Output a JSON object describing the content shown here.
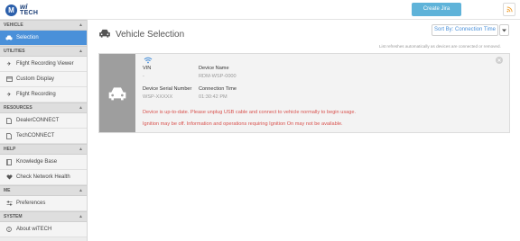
{
  "header": {
    "logo_badge": "M",
    "logo_wi": "wi",
    "logo_tech": "TECH",
    "create_jira": "Create Jira"
  },
  "sidebar": {
    "sections": [
      {
        "title": "VEHICLE",
        "items": [
          {
            "label": "Selection",
            "icon": "car-icon",
            "active": true
          }
        ]
      },
      {
        "title": "UTILITIES",
        "items": [
          {
            "label": "Flight Recording Viewer",
            "icon": "airplane-icon"
          },
          {
            "label": "Custom Display",
            "icon": "window-icon"
          },
          {
            "label": "Flight Recording",
            "icon": "airplane-icon"
          }
        ]
      },
      {
        "title": "RESOURCES",
        "items": [
          {
            "label": "DealerCONNECT",
            "icon": "document-icon"
          },
          {
            "label": "TechCONNECT",
            "icon": "document-icon"
          }
        ]
      },
      {
        "title": "HELP",
        "items": [
          {
            "label": "Knowledge Base",
            "icon": "book-icon"
          },
          {
            "label": "Check Network Health",
            "icon": "heartbeat-icon"
          }
        ]
      },
      {
        "title": "ME",
        "items": [
          {
            "label": "Preferences",
            "icon": "sliders-icon"
          }
        ]
      },
      {
        "title": "SYSTEM",
        "items": [
          {
            "label": "About wiTECH",
            "icon": "info-icon"
          }
        ]
      }
    ]
  },
  "main": {
    "title": "Vehicle Selection",
    "sort_label": "Sort By: Connection Time",
    "hint": "List refreshes automatically as devices are connected or removed."
  },
  "device": {
    "vin_label": "VIN",
    "vin_value": "-",
    "device_name_label": "Device Name",
    "device_name_value": "RDM-WSP-0000",
    "serial_label": "Device Serial Number",
    "serial_value": "WSP-XXXXX",
    "connection_time_label": "Connection Time",
    "connection_time_value": "01:30:42 PM",
    "message_1": "Device is up-to-date. Please unplug USB cable and connect to vehicle normally to begin usage.",
    "message_2": "Ignition may be off. Information and operations requiring Ignition On may not be available."
  },
  "colors": {
    "accent": "#4a90d9",
    "jira": "#5fb3d9",
    "error": "#d9534f",
    "car_panel": "#9e9e9e"
  }
}
